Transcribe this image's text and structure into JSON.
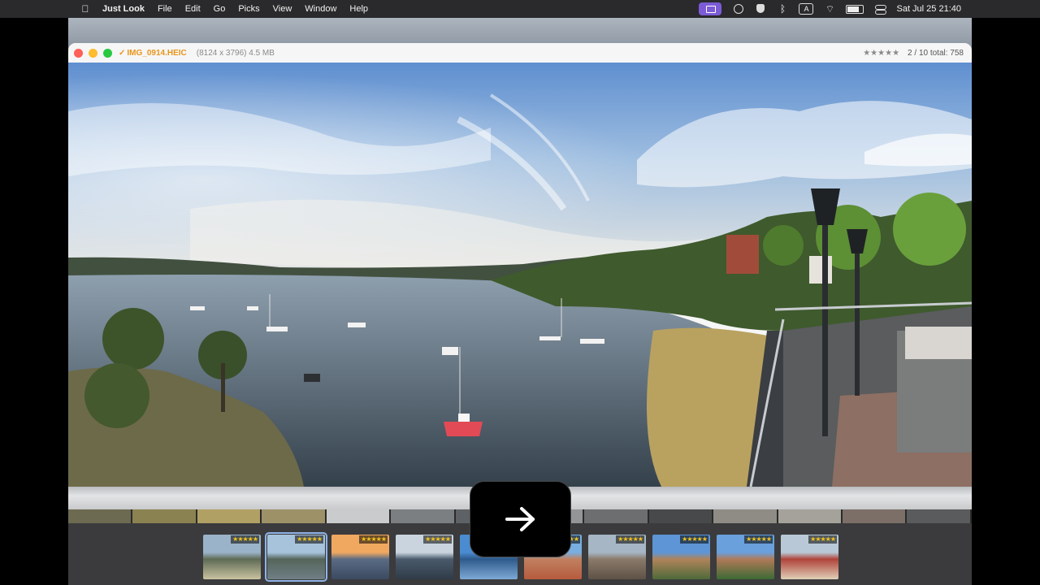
{
  "menubar": {
    "app_name": "Just Look",
    "items": [
      "File",
      "Edit",
      "Go",
      "Picks",
      "View",
      "Window",
      "Help"
    ],
    "clock": "Sat Jul 25  21:40",
    "input_indicator": "A"
  },
  "window": {
    "filename": "IMG_0914.HEIC",
    "file_info": "(8124 x 3796) 4.5 MB",
    "rating": "★★★★★",
    "position": "2 / 10 total: 758"
  },
  "filmstrip": {
    "selected_index": 1,
    "thumb_rating": "★★★★★",
    "thumbs": [
      {
        "name": "lake-view",
        "colors": [
          "#9bb3c8",
          "#5e6b55",
          "#c9c3a0"
        ]
      },
      {
        "name": "harbour-panorama",
        "colors": [
          "#a7c3dc",
          "#55655a",
          "#6f7f86"
        ]
      },
      {
        "name": "sunset",
        "colors": [
          "#f0a860",
          "#5a6b84",
          "#3b4a60"
        ]
      },
      {
        "name": "coast-clouds",
        "colors": [
          "#c9d4df",
          "#4a5a6b",
          "#2f3b48"
        ]
      },
      {
        "name": "blue-sea",
        "colors": [
          "#4b8bd1",
          "#2d5a8a",
          "#7ea9d6"
        ]
      },
      {
        "name": "harbour-boats",
        "colors": [
          "#78aee0",
          "#c08060",
          "#b65b3e"
        ]
      },
      {
        "name": "town-square",
        "colors": [
          "#a6b6c4",
          "#8a7a6a",
          "#5e5146"
        ]
      },
      {
        "name": "castle",
        "colors": [
          "#5d95d6",
          "#b0835a",
          "#4d6a3a"
        ]
      },
      {
        "name": "palace-garden",
        "colors": [
          "#6aa0dc",
          "#b07a58",
          "#3c6a35"
        ]
      },
      {
        "name": "red-street",
        "colors": [
          "#b8c8d6",
          "#b0433a",
          "#e0d0b8"
        ]
      }
    ]
  },
  "overlay": {
    "next_icon": "right-arrow-icon"
  }
}
